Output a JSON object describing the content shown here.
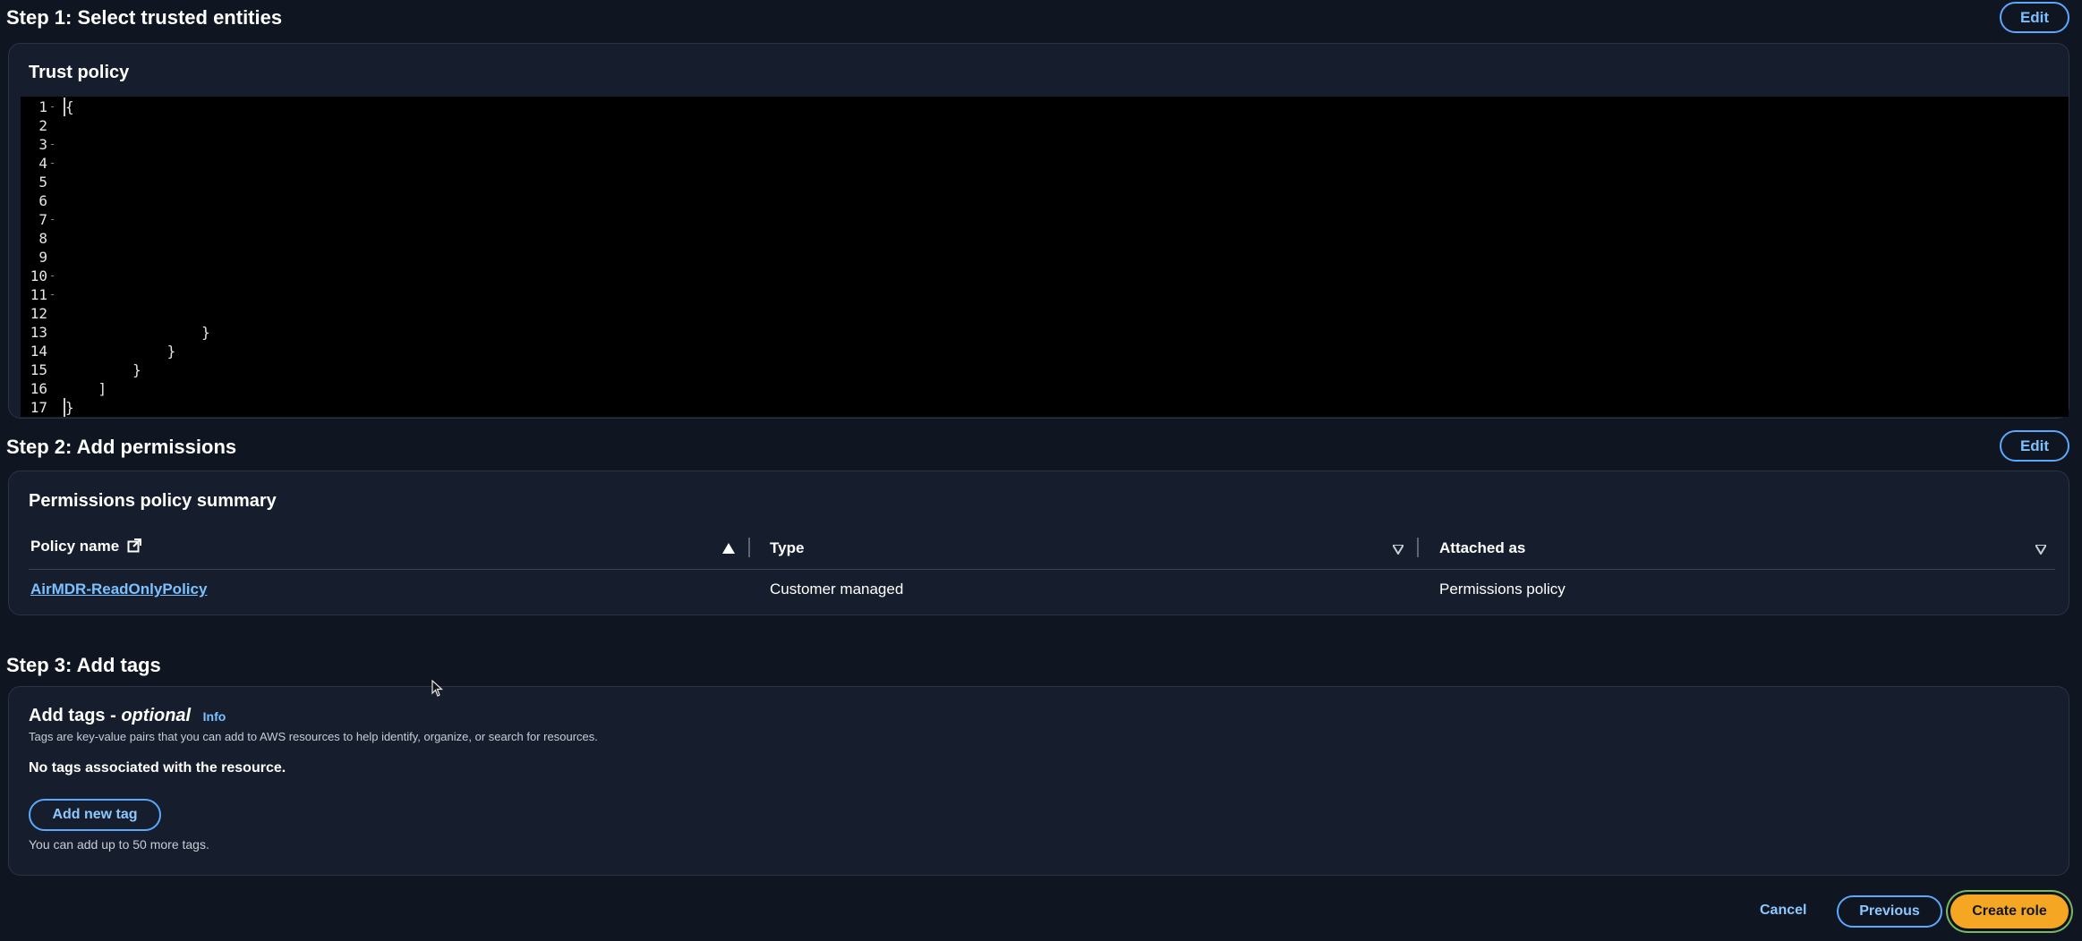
{
  "step1": {
    "title": "Step 1: Select trusted entities",
    "edit_label": "Edit",
    "panel_title": "Trust policy",
    "code_lines": [
      {
        "n": "1",
        "fold": true,
        "text": "{"
      },
      {
        "n": "2",
        "fold": false,
        "text": ""
      },
      {
        "n": "3",
        "fold": true,
        "text": ""
      },
      {
        "n": "4",
        "fold": true,
        "text": ""
      },
      {
        "n": "5",
        "fold": false,
        "text": ""
      },
      {
        "n": "6",
        "fold": false,
        "text": ""
      },
      {
        "n": "7",
        "fold": true,
        "text": ""
      },
      {
        "n": "8",
        "fold": false,
        "text": ""
      },
      {
        "n": "9",
        "fold": false,
        "text": ""
      },
      {
        "n": "10",
        "fold": true,
        "text": ""
      },
      {
        "n": "11",
        "fold": true,
        "text": ""
      },
      {
        "n": "12",
        "fold": false,
        "text": ""
      },
      {
        "n": "13",
        "fold": false,
        "text": "                }"
      },
      {
        "n": "14",
        "fold": false,
        "text": "            }"
      },
      {
        "n": "15",
        "fold": false,
        "text": "        }"
      },
      {
        "n": "16",
        "fold": false,
        "text": "    ]"
      },
      {
        "n": "17",
        "fold": false,
        "text": "}"
      }
    ]
  },
  "step2": {
    "title": "Step 2: Add permissions",
    "edit_label": "Edit",
    "panel_title": "Permissions policy summary",
    "columns": [
      "Policy name",
      "Type",
      "Attached as"
    ],
    "rows": [
      {
        "policy_name": "AirMDR-ReadOnlyPolicy",
        "type": "Customer managed",
        "attached_as": "Permissions policy"
      }
    ]
  },
  "step3": {
    "title": "Step 3: Add tags",
    "panel_title_main": "Add tags - ",
    "panel_title_optional": "optional",
    "info_label": "Info",
    "description": "Tags are key-value pairs that you can add to AWS resources to help identify, organize, or search for resources.",
    "empty_message": "No tags associated with the resource.",
    "add_button": "Add new tag",
    "limit_note": "You can add up to 50 more tags."
  },
  "footer": {
    "cancel": "Cancel",
    "previous": "Previous",
    "create": "Create role"
  },
  "colors": {
    "background": "#0f1622",
    "panel": "#161e2d",
    "link": "#7cc0ff",
    "primary": "#f5a623"
  }
}
